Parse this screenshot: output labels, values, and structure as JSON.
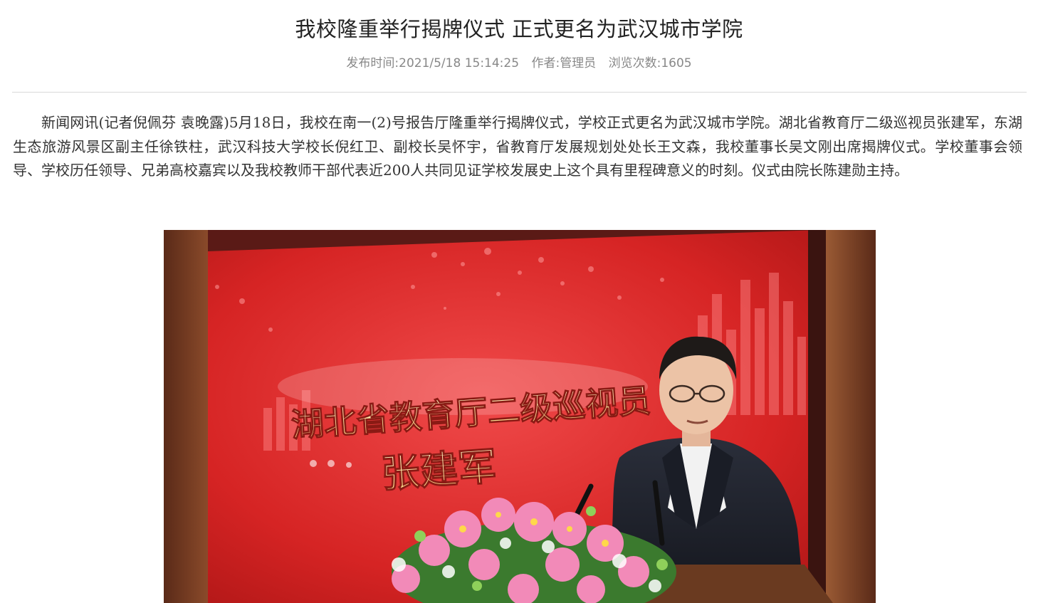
{
  "article": {
    "title": "我校隆重举行揭牌仪式 正式更名为武汉城市学院",
    "meta": {
      "publish_label": "发布时间:",
      "publish_time": "2021/5/18 15:14:25",
      "author_label": "作者:",
      "author": "管理员",
      "views_label": "浏览次数:",
      "views": "1605"
    },
    "body": "新闻网讯(记者倪佩芬  袁晚露)5月18日，我校在南一(2)号报告厅隆重举行揭牌仪式，学校正式更名为武汉城市学院。湖北省教育厅二级巡视员张建军，东湖生态旅游风景区副主任徐铁柱，武汉科技大学校长倪红卫、副校长吴怀宇，省教育厅发展规划处处长王文森，我校董事长吴文刚出席揭牌仪式。学校董事会领导、学校历任领导、兄弟高校嘉宾以及我校教师干部代表近200人共同见证学校发展史上这个具有里程碑意义的时刻。仪式由院长陈建勋主持。"
  },
  "photo": {
    "banner_line1": "湖北省教育厅二级巡视员",
    "banner_line2": "张建军"
  }
}
